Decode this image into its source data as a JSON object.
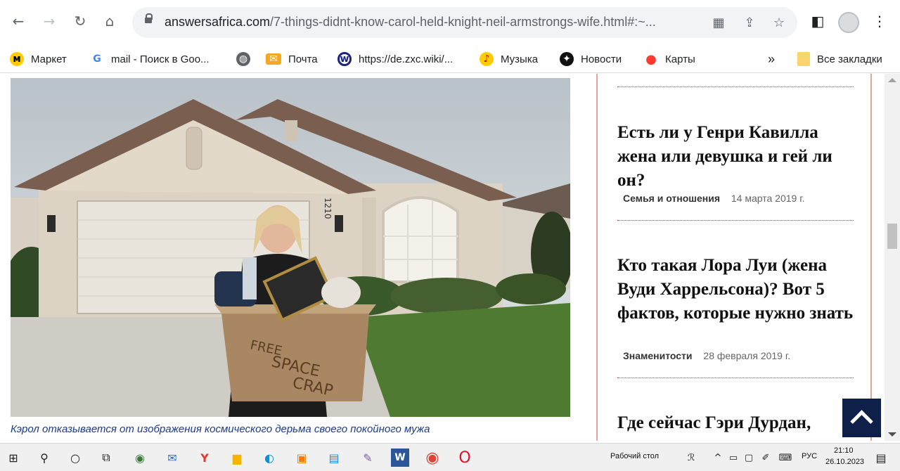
{
  "browser": {
    "url_host": "answersafrica.com",
    "url_path": "/7-things-didnt-know-carol-held-knight-neil-armstrongs-wife.html#:~..."
  },
  "bookmarks": {
    "items": [
      {
        "label": "Маркет",
        "icon": "market-icon",
        "color": "#ffcc00"
      },
      {
        "label": "mail - Поиск в Goo...",
        "icon": "google-icon",
        "color": "#4285f4"
      },
      {
        "label": "",
        "icon": "globe-icon",
        "color": "#5f6368"
      },
      {
        "label": "Почта",
        "icon": "mail-icon",
        "color": "#f5a623"
      },
      {
        "label": "https://de.zxc.wiki/...",
        "icon": "wiki-icon",
        "color": "#1a237e"
      },
      {
        "label": "Музыка",
        "icon": "music-icon",
        "color": "#ffcc00"
      },
      {
        "label": "Новости",
        "icon": "news-icon",
        "color": "#111111"
      },
      {
        "label": "Карты",
        "icon": "maps-icon",
        "color": "#ff3b30"
      }
    ],
    "overflow": "»",
    "all_bookmarks": "Все закладки"
  },
  "article": {
    "caption": "Кэрол отказывается от изображения космического дерьма своего покойного мужа",
    "box_text_1": "FREE",
    "box_text_2": "SPACE",
    "box_text_3": "CRAP",
    "house_number": "1210"
  },
  "sidebar": {
    "articles": [
      {
        "title": "Есть ли у Генри Кавилла жена или девушка и гей ли он?",
        "category": "Семья и отношения",
        "date": "14 марта 2019 г."
      },
      {
        "title": "Кто такая Лора Луи (жена Вуди Харрельсона)? Вот 5 фактов, которые нужно знать",
        "category": "Знаменитости",
        "date": "28 февраля 2019 г."
      },
      {
        "title": "Где сейчас Гэри Дурдан,",
        "category": "",
        "date": ""
      }
    ]
  },
  "taskbar": {
    "desktop_label": "Рабочий стол",
    "lang": "РУС",
    "time": "21:10",
    "date": "26.10.2023"
  }
}
